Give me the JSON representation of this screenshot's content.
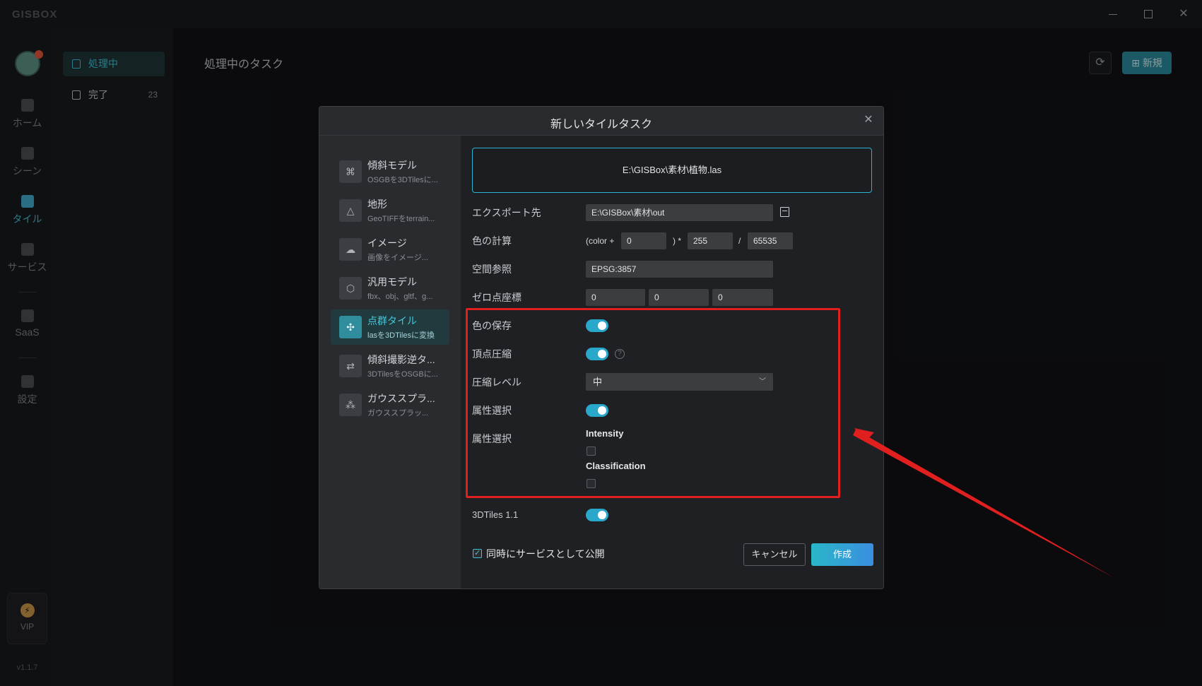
{
  "app": {
    "logo": "GISBOX",
    "version": "v1.1.7"
  },
  "leftnav": {
    "items": [
      {
        "label": "ホーム"
      },
      {
        "label": "シーン"
      },
      {
        "label": "タイル"
      },
      {
        "label": "サービス"
      },
      {
        "label": "SaaS"
      },
      {
        "label": "設定"
      }
    ],
    "vip_label": "VIP"
  },
  "subnav": {
    "items": [
      {
        "label": "処理中",
        "count": ""
      },
      {
        "label": "完了",
        "count": "23"
      }
    ]
  },
  "main": {
    "title": "処理中のタスク",
    "new_button": "新規"
  },
  "dialog": {
    "title": "新しいタイルタスク",
    "types": [
      {
        "name": "傾斜モデル",
        "desc": "OSGBを3DTilesに..."
      },
      {
        "name": "地形",
        "desc": "GeoTIFFをterrain..."
      },
      {
        "name": "イメージ",
        "desc": "画像をイメージ..."
      },
      {
        "name": "汎用モデル",
        "desc": "fbx、obj、gltf、g..."
      },
      {
        "name": "点群タイル",
        "desc": "lasを3DTilesに変換"
      },
      {
        "name": "傾斜撮影逆タ...",
        "desc": "3DTilesをOSGBに..."
      },
      {
        "name": "ガウススプラ...",
        "desc": "ガウススプラッ..."
      }
    ],
    "file_path": "E:\\GISBox\\素材\\植物.las",
    "form": {
      "export_label": "エクスポート先",
      "export_value": "E:\\GISBox\\素材\\out",
      "color_calc_label": "色の計算",
      "color_prefix": "(color +",
      "color_add": "0",
      "color_mid": ") *",
      "color_mul": "255",
      "color_div_sign": "/",
      "color_div": "65535",
      "srs_label": "空間参照",
      "srs_value": "EPSG:3857",
      "origin_label": "ゼロ点座標",
      "origin": [
        "0",
        "0",
        "0"
      ],
      "keep_color_label": "色の保存",
      "keep_color": true,
      "vertex_compress_label": "頂点圧縮",
      "vertex_compress": true,
      "compress_level_label": "圧縮レベル",
      "compress_level_value": "中",
      "attr_select_label": "属性選択",
      "attr_select": true,
      "attr_list_label": "属性選択",
      "attributes": [
        {
          "name": "Intensity",
          "checked": false
        },
        {
          "name": "Classification",
          "checked": false
        }
      ],
      "tiles11_label": "3DTiles 1.1",
      "tiles11": true
    },
    "publish_label": "同時にサービスとして公開",
    "publish_checked": true,
    "cancel_label": "キャンセル",
    "create_label": "作成"
  },
  "colors": {
    "accent": "#2aa8cc",
    "highlight": "#e01f1f"
  }
}
